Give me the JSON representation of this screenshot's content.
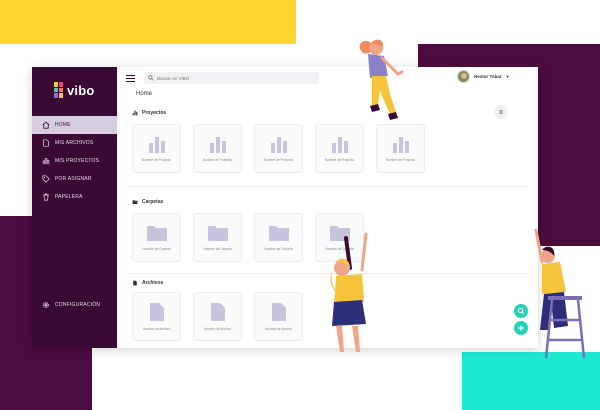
{
  "colors": {
    "yellow": "#fdd730",
    "plum": "#4d0c3f",
    "sidebar": "#3a0a34",
    "teal": "#1de9d2",
    "fab": "#22d3ba",
    "folder": "#c7c4de"
  },
  "app": {
    "logo_text": "vibo",
    "breadcrumb": "Home"
  },
  "sidebar": {
    "items": [
      {
        "label": "HOME",
        "icon": "home-icon"
      },
      {
        "label": "MIS ARCHIVOS",
        "icon": "file-icon"
      },
      {
        "label": "MIS PROYECTOS",
        "icon": "project-icon"
      },
      {
        "label": "POR ASIGNAR",
        "icon": "tag-icon"
      },
      {
        "label": "PAPELERA",
        "icon": "trash-icon"
      }
    ],
    "config_label": "CONFIGURACIÓN"
  },
  "topbar": {
    "search_placeholder": "Buscar en VIBO",
    "user_name": "Nestor Tobar"
  },
  "sections": {
    "proyectos": {
      "title": "Proyectos",
      "items": [
        "Nombre de Proyecto",
        "Nombre de Proyecto",
        "Nombre de Proyecto",
        "Nombre de Proyecto",
        "Nombre de Proyecto"
      ]
    },
    "carpetas": {
      "title": "Carpetas",
      "items": [
        "Nombre de Carpeta",
        "Nombre de Carpeta",
        "Nombre de Carpeta",
        "Nombre de Carpeta"
      ]
    },
    "archivos": {
      "title": "Archivos",
      "items": [
        "Nombre de Archivo",
        "Nombre de Archivo",
        "Nombre de Archivo"
      ]
    }
  }
}
